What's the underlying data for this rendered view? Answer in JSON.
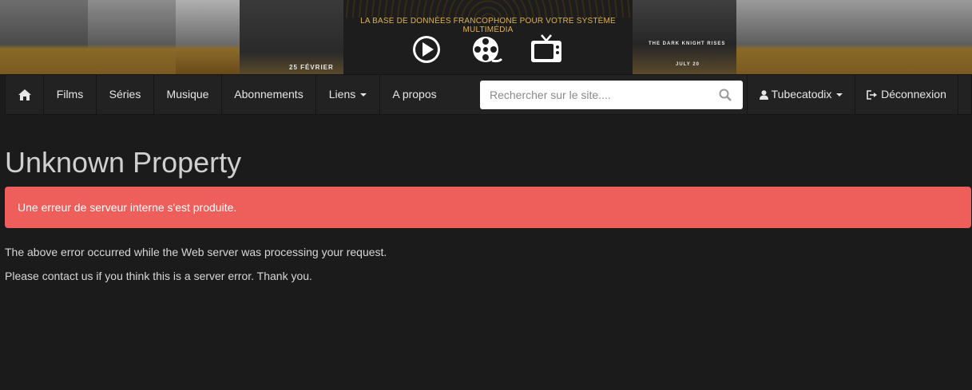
{
  "banner": {
    "tagline": "LA BASE DE DONNÉES FRANCOPHONE POUR VOTRE SYSTÈME MULTIMÉDIA",
    "poster_date": "25 FÉVRIER",
    "poster_title": "THE DARK KNIGHT RISES",
    "poster_release": "JULY 20",
    "icons": [
      "play-icon",
      "film-reel-icon",
      "tv-icon"
    ]
  },
  "nav": {
    "items": [
      {
        "label": "Films"
      },
      {
        "label": "Séries"
      },
      {
        "label": "Musique"
      },
      {
        "label": "Abonnements"
      },
      {
        "label": "Liens"
      },
      {
        "label": "A propos"
      }
    ],
    "search_placeholder": "Rechercher sur le site....",
    "user_label": "Tubecatodix",
    "logout_label": "Déconnexion"
  },
  "content": {
    "title": "Unknown Property",
    "alert": "Une erreur de serveur interne s'est produite.",
    "paragraphs": [
      "The above error occurred while the Web server was processing your request.",
      "Please contact us if you think this is a server error. Thank you."
    ]
  },
  "colors": {
    "background": "#1b1b1b",
    "navbar": "#222222",
    "alert": "#ee5f5b",
    "accent": "#e0b24a"
  }
}
